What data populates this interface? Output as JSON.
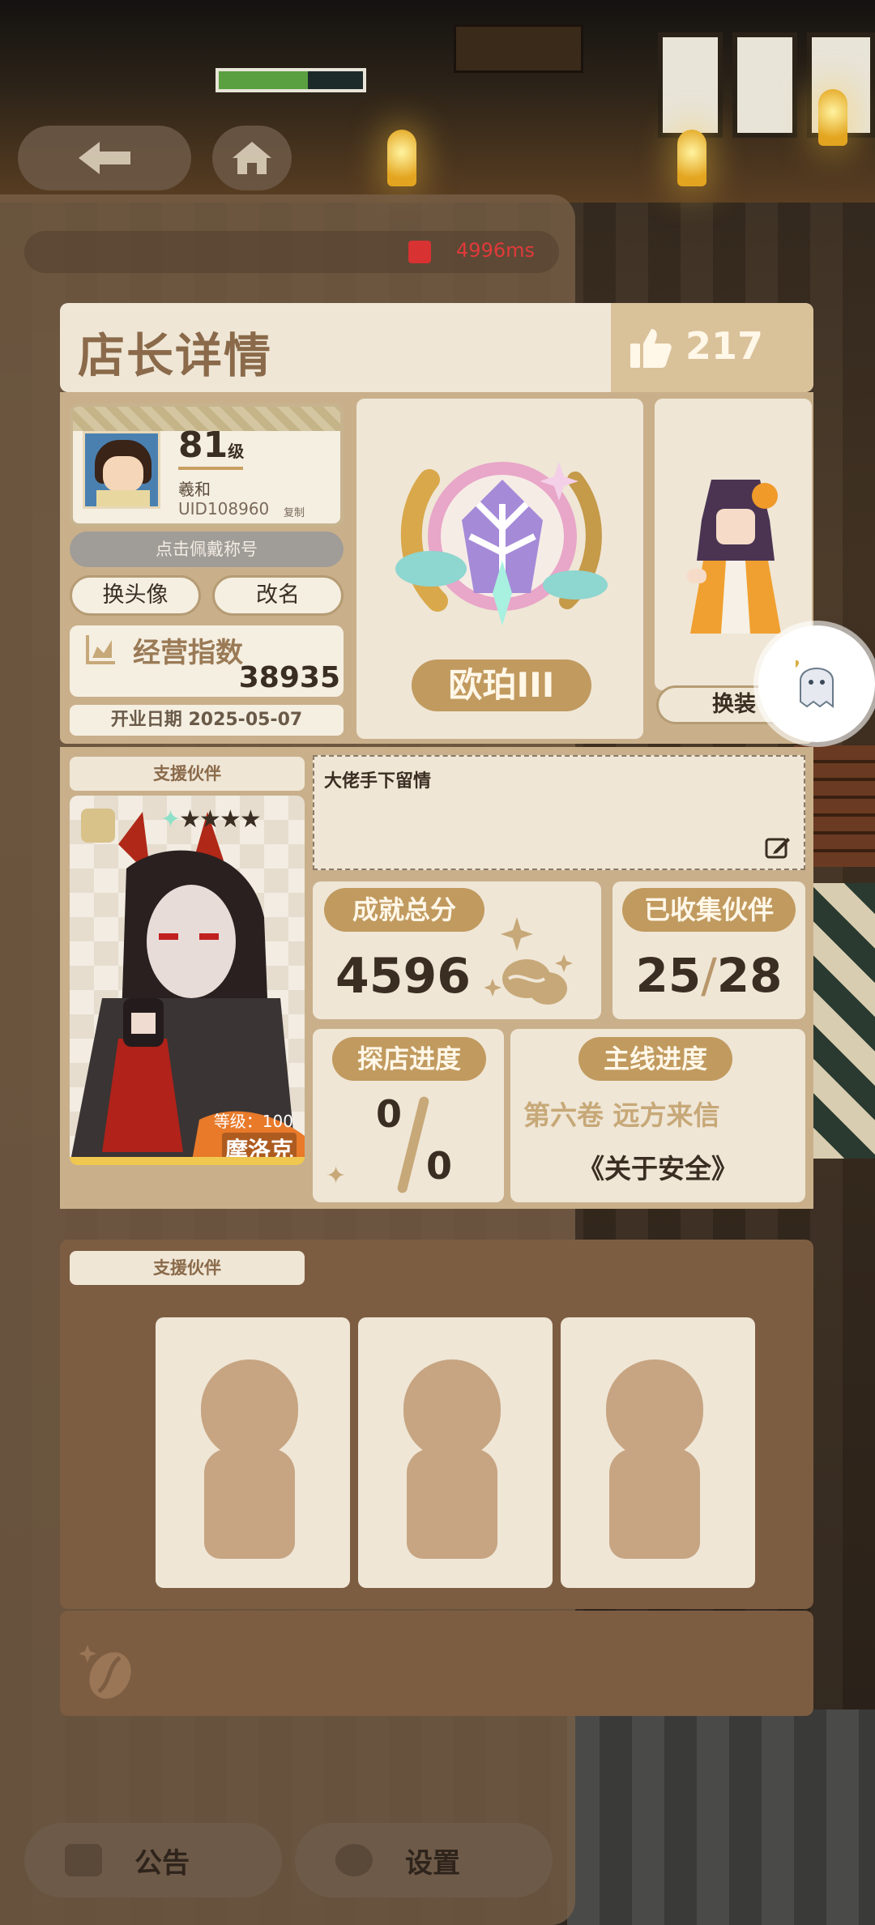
{
  "top": {
    "ping": "4996ms",
    "energy_fill": 0.62
  },
  "card": {
    "title": "店长详情",
    "likes": "217"
  },
  "profile": {
    "level": "81",
    "level_unit": "级",
    "name": "羲和",
    "uid": "UID108960",
    "copy_label": "复制",
    "title_prompt": "点击佩戴称号",
    "change_avatar": "换头像",
    "rename": "改名",
    "business_index_label": "经营指数",
    "business_index_value": "38935",
    "open_date": "开业日期 2025-05-07"
  },
  "rank": {
    "label": "欧珀III"
  },
  "outfit": {
    "button": "换装"
  },
  "partner": {
    "tag": "支援伙伴",
    "level": "等级：100",
    "name": "摩洛克",
    "stars": 5
  },
  "message": {
    "text": "大佬手下留情"
  },
  "stats": {
    "score_label": "成就总分",
    "score_value": "4596",
    "collect_label": "已收集伙伴",
    "collect_have": "25",
    "collect_sep": "/",
    "collect_total": "28",
    "visit_label": "探店进度",
    "visit_num": "0",
    "visit_den": "0",
    "story_label": "主线进度",
    "story_chapter": "第六卷 远方来信",
    "story_sub": "《关于安全》"
  },
  "support": {
    "tag": "支援伙伴"
  },
  "bottom": {
    "notice": "公告",
    "settings": "设置"
  },
  "colors": {
    "panel": "#efe6d6",
    "frame": "#c9b08b",
    "accent": "#c19a5f",
    "dark_section": "#7d5d42"
  }
}
